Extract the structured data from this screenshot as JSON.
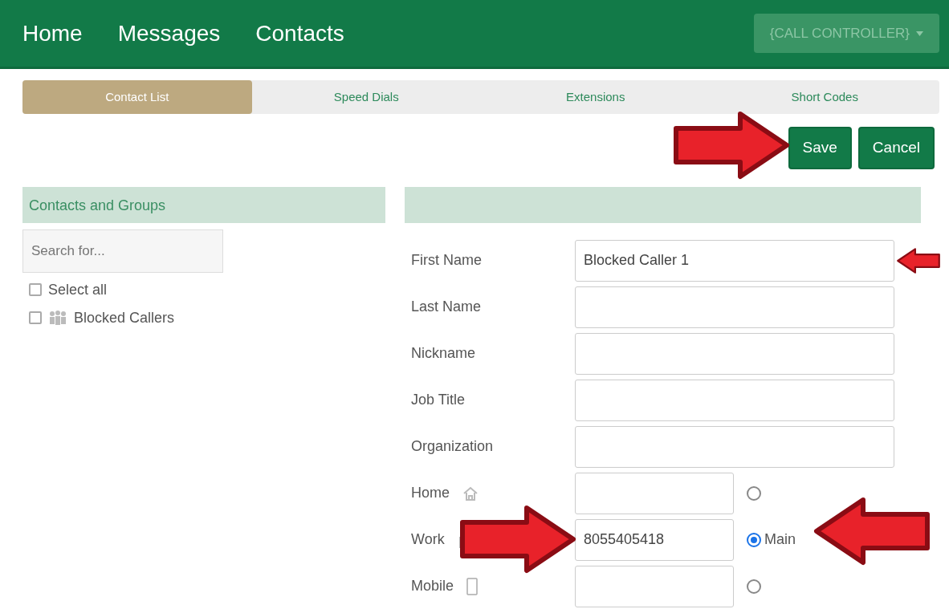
{
  "nav": {
    "links": [
      "Home",
      "Messages",
      "Contacts"
    ],
    "dropdown": "{CALL CONTROLLER}"
  },
  "tabs": [
    {
      "label": "Contact List",
      "selected": true
    },
    {
      "label": "Speed Dials",
      "selected": false
    },
    {
      "label": "Extensions",
      "selected": false
    },
    {
      "label": "Short Codes",
      "selected": false
    }
  ],
  "actions": [
    {
      "label": "Save",
      "arrow_left": true
    },
    {
      "label": "Cancel"
    }
  ],
  "contacts_panel": {
    "title": "Contacts and Groups",
    "search": {
      "placeholder": "Search for..."
    },
    "select_all": {
      "label": "Select all",
      "checked": false
    },
    "groups": [
      {
        "label": "Blocked Callers",
        "checked": false
      }
    ]
  },
  "form": [
    {
      "kind": "text",
      "label": "First Name",
      "value": "Blocked Caller 1",
      "arrow_right": true
    },
    {
      "kind": "text",
      "label": "Last Name"
    },
    {
      "kind": "text",
      "label": "Nickname"
    },
    {
      "kind": "text",
      "label": "Job Title"
    },
    {
      "kind": "text",
      "label": "Organization"
    },
    {
      "kind": "home",
      "label": "Home",
      "main": false
    },
    {
      "kind": "work",
      "label": "Work",
      "value": "8055405418",
      "main": true,
      "main_label": "Main",
      "arrow_left": true,
      "main_arrow_right": true
    },
    {
      "kind": "mobile",
      "label": "Mobile",
      "main": false
    }
  ]
}
